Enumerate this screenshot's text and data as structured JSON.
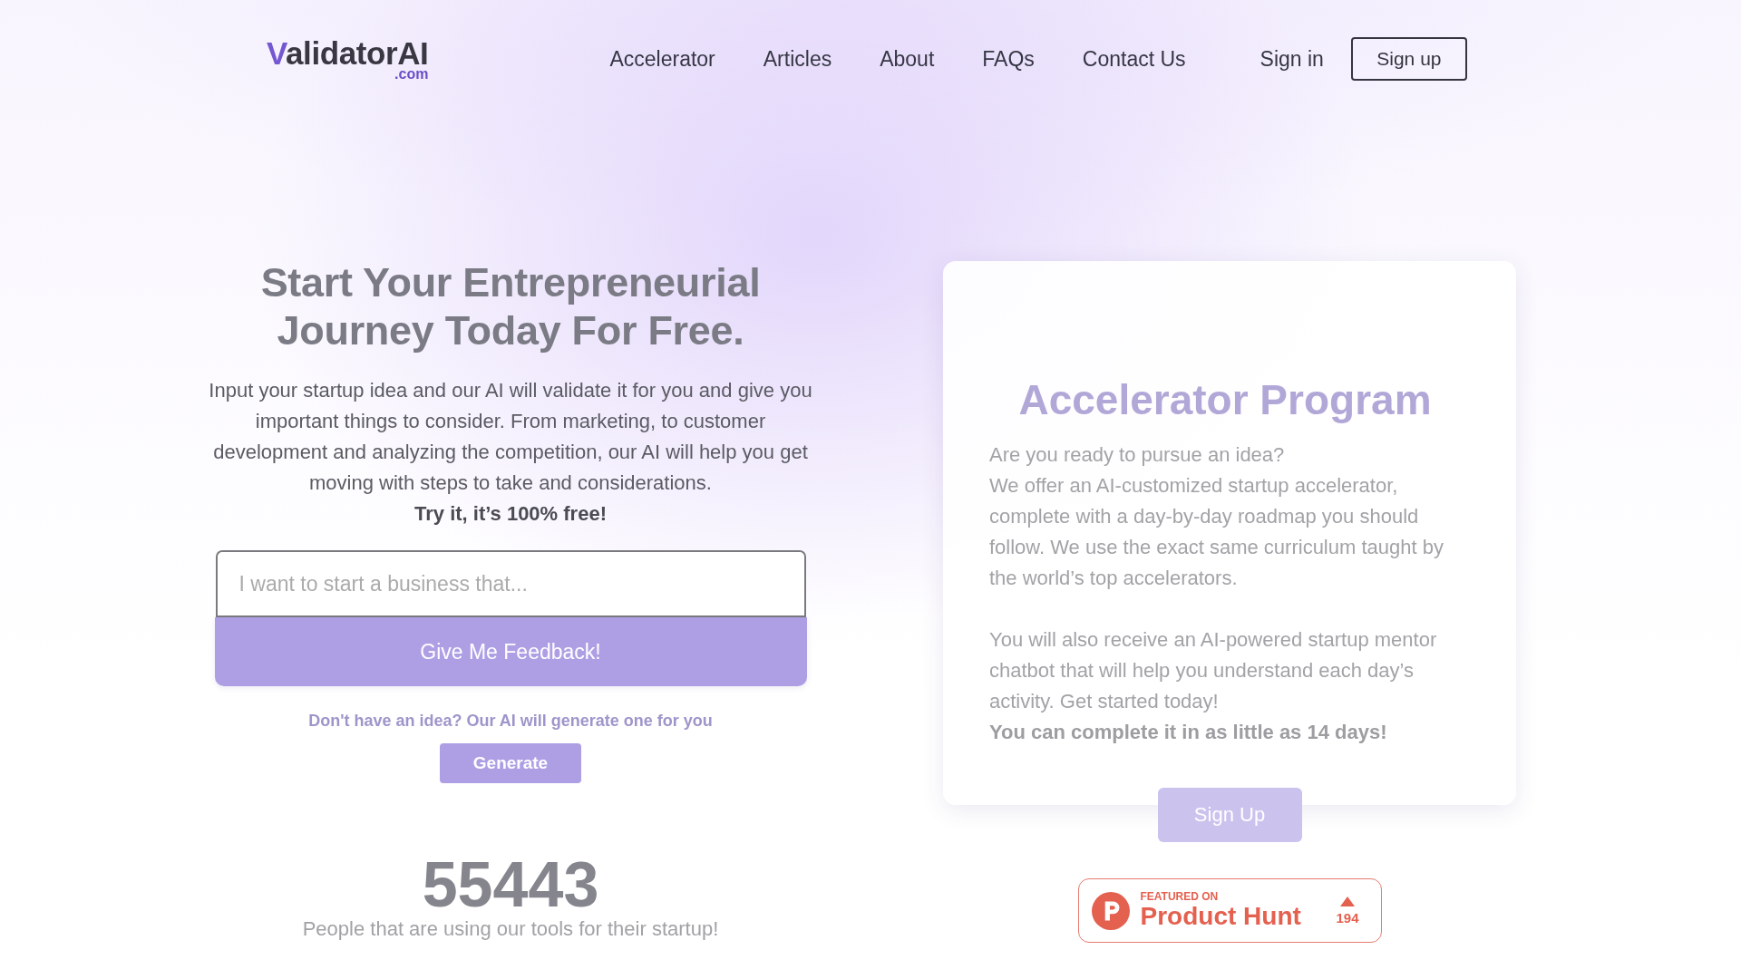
{
  "header": {
    "logo": {
      "name": "ValidatorAI",
      "domain": ".com"
    },
    "nav_links": [
      "Accelerator",
      "Articles",
      "About",
      "FAQs",
      "Contact Us"
    ],
    "sign_in": "Sign in",
    "sign_up": "Sign up"
  },
  "hero": {
    "title": "Start Your Entrepreneurial Journey Today For Free.",
    "description": "Input your startup idea and our AI will validate it for you and give you important things to consider. From marketing, to customer development and analyzing the competition, our AI will help you get moving with steps to take and considerations.",
    "callout": "Try it, it’s 100% free!",
    "idea_field": {
      "placeholder": "I want to start a business that..."
    },
    "submit_button": "Give Me Feedback!",
    "generate_prompt": "Don't have an idea? Our AI will generate one for you",
    "generate_button": "Generate",
    "user_count": "55443",
    "user_count_caption": "People that are using our tools for their startup!"
  },
  "accelerator": {
    "title": "Accelerator Program",
    "intro": "Are you ready to pursue an idea?",
    "paragraphs": [
      "We offer an AI-customized startup accelerator, complete with a day-by-day roadmap you should follow. We use the exact same curriculum taught by the world’s top accelerators.",
      "You will also receive an AI-powered startup mentor chatbot that will help you understand each day’s activity. Get started today!"
    ],
    "highlight": "You can complete it in as little as 14 days!",
    "sign_up_button": "Sign Up"
  },
  "product_hunt_badge": {
    "eyebrow": "FEATURED ON",
    "title": "Product Hunt",
    "upvotes": "194"
  }
}
